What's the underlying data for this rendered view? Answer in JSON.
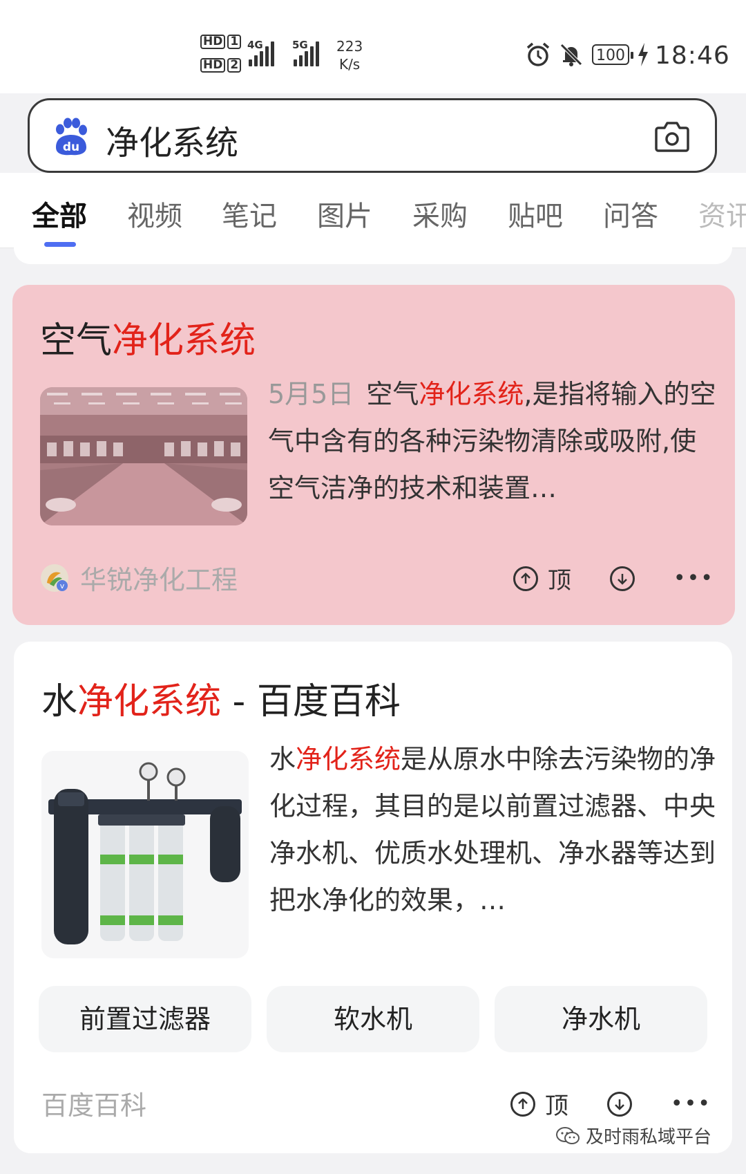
{
  "status_bar": {
    "sim1_label": "HD",
    "sim1_index": "1",
    "sim2_label": "HD",
    "sim2_index": "2",
    "net1": "4G",
    "net2": "5G",
    "speed_value": "223",
    "speed_unit": "K/s",
    "battery": "100",
    "time": "18:46",
    "icons": [
      "alarm-icon",
      "mute-bell-icon",
      "battery-icon",
      "charging-icon"
    ]
  },
  "search": {
    "logo_icon": "baidu-paw-icon",
    "query": "净化系统",
    "camera_icon": "camera-icon"
  },
  "tabs": [
    {
      "label": "全部",
      "active": true
    },
    {
      "label": "视频"
    },
    {
      "label": "笔记"
    },
    {
      "label": "图片"
    },
    {
      "label": "采购"
    },
    {
      "label": "贴吧"
    },
    {
      "label": "问答"
    },
    {
      "label": "资讯"
    }
  ],
  "results": [
    {
      "title_prefix": "空气",
      "title_highlight": "净化系统",
      "date": "5月5日",
      "snippet_prefix": "空气",
      "snippet_highlight": "净化系统",
      "snippet_rest": ",是指将输入的空气中含有的各种污染物清除或吸附,使空气洁净的技术和装置…",
      "source": "华锐净化工程",
      "up_label": "顶",
      "highlight_color": "#f4c7cc"
    },
    {
      "title_prefix": "水",
      "title_highlight": "净化系统",
      "title_suffix": " - 百度百科",
      "snippet_prefix": "水",
      "snippet_highlight": "净化系统",
      "snippet_rest": "是从原水中除去污染物的净化过程，其目的是以前置过滤器、中央净水机、优质水处理机、净水器等达到把水净化的效果，…",
      "related_tags": [
        "前置过滤器",
        "软水机",
        "净水机"
      ],
      "source": "百度百科",
      "up_label": "顶"
    }
  ],
  "watermark": "及时雨私域平台",
  "colors": {
    "accent": "#4e6ef2",
    "keyword_red": "#e2231a",
    "highlight_card": "#f4c7cc"
  }
}
